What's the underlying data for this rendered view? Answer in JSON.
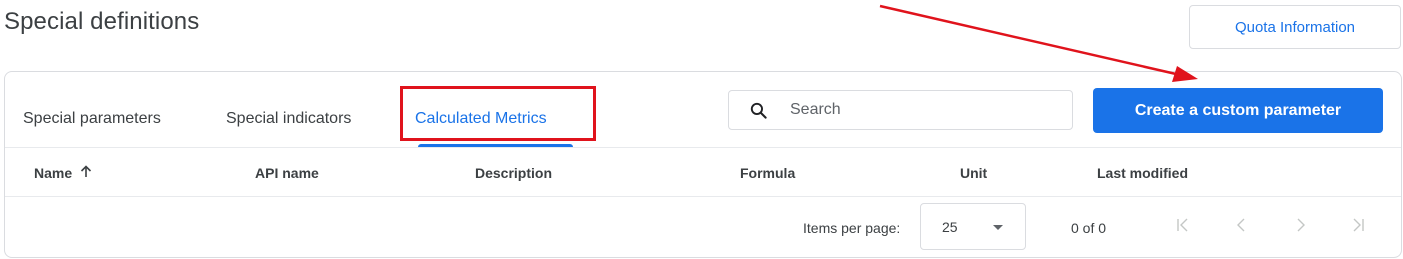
{
  "page": {
    "title": "Special definitions"
  },
  "header": {
    "quota_button_label": "Quota Information"
  },
  "tabs": [
    {
      "label": "Special parameters",
      "active": false
    },
    {
      "label": "Special indicators",
      "active": false
    },
    {
      "label": "Calculated Metrics",
      "active": true
    }
  ],
  "search": {
    "placeholder": "Search",
    "value": ""
  },
  "create_button_label": "Create a custom parameter",
  "table": {
    "columns": [
      "Name",
      "API name",
      "Description",
      "Formula",
      "Unit",
      "Last modified"
    ],
    "sort": {
      "column": "Name",
      "direction": "ascending",
      "icon": "arrow-up-icon"
    },
    "rows": []
  },
  "pagination": {
    "items_per_page_label": "Items per page:",
    "items_per_page_value": "25",
    "range_text": "0 of 0"
  },
  "colors": {
    "accent": "#1a73e8",
    "annotation_red": "#e0131c",
    "border": "#dadce0",
    "text": "#3c4043"
  }
}
